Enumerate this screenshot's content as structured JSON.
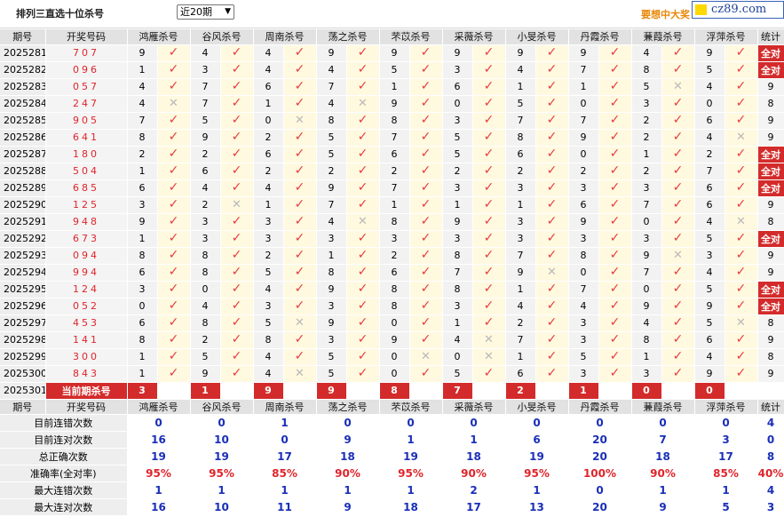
{
  "page": {
    "title": "排列三直选十位杀号",
    "period_select": "近20期",
    "promo": "要想中大奖",
    "logo": "cz89.com"
  },
  "columns": {
    "period": "期号",
    "draw": "开奖号码",
    "killers": [
      "鸿雁杀号",
      "谷风杀号",
      "周南杀号",
      "荡之杀号",
      "芣苡杀号",
      "采薇杀号",
      "小旻杀号",
      "丹霞杀号",
      "蒹葭杀号",
      "浮萍杀号"
    ],
    "total": "统计"
  },
  "marks": {
    "check": "✓",
    "cross": "✕"
  },
  "rows": [
    {
      "period": "2025281",
      "draw": "707",
      "kills": [
        "9",
        "4",
        "4",
        "9",
        "9",
        "9",
        "9",
        "9",
        "4",
        "9"
      ],
      "hits": [
        1,
        1,
        1,
        1,
        1,
        1,
        1,
        1,
        1,
        1
      ],
      "total": "全对"
    },
    {
      "period": "2025282",
      "draw": "096",
      "kills": [
        "1",
        "3",
        "4",
        "4",
        "5",
        "3",
        "4",
        "7",
        "8",
        "5"
      ],
      "hits": [
        1,
        1,
        1,
        1,
        1,
        1,
        1,
        1,
        1,
        1
      ],
      "total": "全对"
    },
    {
      "period": "2025283",
      "draw": "057",
      "kills": [
        "4",
        "7",
        "6",
        "7",
        "1",
        "6",
        "1",
        "1",
        "5",
        "4"
      ],
      "hits": [
        1,
        1,
        1,
        1,
        1,
        1,
        1,
        1,
        0,
        1
      ],
      "total": "9"
    },
    {
      "period": "2025284",
      "draw": "247",
      "kills": [
        "4",
        "7",
        "1",
        "4",
        "9",
        "0",
        "5",
        "0",
        "3",
        "0"
      ],
      "hits": [
        0,
        1,
        1,
        0,
        1,
        1,
        1,
        1,
        1,
        1
      ],
      "total": "8"
    },
    {
      "period": "2025285",
      "draw": "905",
      "kills": [
        "7",
        "5",
        "0",
        "8",
        "8",
        "3",
        "7",
        "7",
        "2",
        "6"
      ],
      "hits": [
        1,
        1,
        0,
        1,
        1,
        1,
        1,
        1,
        1,
        1
      ],
      "total": "9"
    },
    {
      "period": "2025286",
      "draw": "641",
      "kills": [
        "8",
        "9",
        "2",
        "5",
        "7",
        "5",
        "8",
        "9",
        "2",
        "4"
      ],
      "hits": [
        1,
        1,
        1,
        1,
        1,
        1,
        1,
        1,
        1,
        0
      ],
      "total": "9"
    },
    {
      "period": "2025287",
      "draw": "180",
      "kills": [
        "2",
        "2",
        "6",
        "5",
        "6",
        "5",
        "6",
        "0",
        "1",
        "2"
      ],
      "hits": [
        1,
        1,
        1,
        1,
        1,
        1,
        1,
        1,
        1,
        1
      ],
      "total": "全对"
    },
    {
      "period": "2025288",
      "draw": "504",
      "kills": [
        "1",
        "6",
        "2",
        "2",
        "2",
        "2",
        "2",
        "2",
        "2",
        "7"
      ],
      "hits": [
        1,
        1,
        1,
        1,
        1,
        1,
        1,
        1,
        1,
        1
      ],
      "total": "全对"
    },
    {
      "period": "2025289",
      "draw": "685",
      "kills": [
        "6",
        "4",
        "4",
        "9",
        "7",
        "3",
        "3",
        "3",
        "3",
        "6"
      ],
      "hits": [
        1,
        1,
        1,
        1,
        1,
        1,
        1,
        1,
        1,
        1
      ],
      "total": "全对"
    },
    {
      "period": "2025290",
      "draw": "125",
      "kills": [
        "3",
        "2",
        "1",
        "7",
        "1",
        "1",
        "1",
        "6",
        "7",
        "6"
      ],
      "hits": [
        1,
        0,
        1,
        1,
        1,
        1,
        1,
        1,
        1,
        1
      ],
      "total": "9"
    },
    {
      "period": "2025291",
      "draw": "948",
      "kills": [
        "9",
        "3",
        "3",
        "4",
        "8",
        "9",
        "3",
        "9",
        "0",
        "4"
      ],
      "hits": [
        1,
        1,
        1,
        0,
        1,
        1,
        1,
        1,
        1,
        0
      ],
      "total": "8"
    },
    {
      "period": "2025292",
      "draw": "673",
      "kills": [
        "1",
        "3",
        "3",
        "3",
        "3",
        "3",
        "3",
        "3",
        "3",
        "5"
      ],
      "hits": [
        1,
        1,
        1,
        1,
        1,
        1,
        1,
        1,
        1,
        1
      ],
      "total": "全对"
    },
    {
      "period": "2025293",
      "draw": "094",
      "kills": [
        "8",
        "8",
        "2",
        "1",
        "2",
        "8",
        "7",
        "8",
        "9",
        "3"
      ],
      "hits": [
        1,
        1,
        1,
        1,
        1,
        1,
        1,
        1,
        0,
        1
      ],
      "total": "9"
    },
    {
      "period": "2025294",
      "draw": "994",
      "kills": [
        "6",
        "8",
        "5",
        "8",
        "6",
        "7",
        "9",
        "0",
        "7",
        "4"
      ],
      "hits": [
        1,
        1,
        1,
        1,
        1,
        1,
        0,
        1,
        1,
        1
      ],
      "total": "9"
    },
    {
      "period": "2025295",
      "draw": "124",
      "kills": [
        "3",
        "0",
        "4",
        "9",
        "8",
        "8",
        "1",
        "7",
        "0",
        "5"
      ],
      "hits": [
        1,
        1,
        1,
        1,
        1,
        1,
        1,
        1,
        1,
        1
      ],
      "total": "全对"
    },
    {
      "period": "2025296",
      "draw": "052",
      "kills": [
        "0",
        "4",
        "3",
        "3",
        "8",
        "3",
        "4",
        "4",
        "9",
        "9"
      ],
      "hits": [
        1,
        1,
        1,
        1,
        1,
        1,
        1,
        1,
        1,
        1
      ],
      "total": "全对"
    },
    {
      "period": "2025297",
      "draw": "453",
      "kills": [
        "6",
        "8",
        "5",
        "9",
        "0",
        "1",
        "2",
        "3",
        "4",
        "5"
      ],
      "hits": [
        1,
        1,
        0,
        1,
        1,
        1,
        1,
        1,
        1,
        0
      ],
      "total": "8"
    },
    {
      "period": "2025298",
      "draw": "141",
      "kills": [
        "8",
        "2",
        "8",
        "3",
        "9",
        "4",
        "7",
        "3",
        "8",
        "6"
      ],
      "hits": [
        1,
        1,
        1,
        1,
        1,
        0,
        1,
        1,
        1,
        1
      ],
      "total": "9"
    },
    {
      "period": "2025299",
      "draw": "300",
      "kills": [
        "1",
        "5",
        "4",
        "5",
        "0",
        "0",
        "1",
        "5",
        "1",
        "4"
      ],
      "hits": [
        1,
        1,
        1,
        1,
        0,
        0,
        1,
        1,
        1,
        1
      ],
      "total": "8"
    },
    {
      "period": "2025300",
      "draw": "843",
      "kills": [
        "1",
        "9",
        "4",
        "5",
        "0",
        "5",
        "6",
        "3",
        "3",
        "9"
      ],
      "hits": [
        1,
        1,
        0,
        1,
        1,
        1,
        1,
        1,
        1,
        1
      ],
      "total": "9"
    }
  ],
  "current": {
    "period": "2025301",
    "label": "当前期杀号",
    "kills": [
      "3",
      "1",
      "9",
      "9",
      "8",
      "7",
      "2",
      "1",
      "0",
      "0"
    ]
  },
  "stats": [
    {
      "label": "目前连错次数",
      "values": [
        "0",
        "0",
        "1",
        "0",
        "0",
        "0",
        "0",
        "0",
        "0",
        "0"
      ],
      "total": "4",
      "type": "n"
    },
    {
      "label": "目前连对次数",
      "values": [
        "16",
        "10",
        "0",
        "9",
        "1",
        "1",
        "6",
        "20",
        "7",
        "3"
      ],
      "total": "0",
      "type": "n"
    },
    {
      "label": "总正确次数",
      "values": [
        "19",
        "19",
        "17",
        "18",
        "19",
        "18",
        "19",
        "20",
        "18",
        "17"
      ],
      "total": "8",
      "type": "n"
    },
    {
      "label": "准确率(全对率)",
      "values": [
        "95%",
        "95%",
        "85%",
        "90%",
        "95%",
        "90%",
        "95%",
        "100%",
        "90%",
        "85%"
      ],
      "total": "40%",
      "type": "p"
    },
    {
      "label": "最大连错次数",
      "values": [
        "1",
        "1",
        "1",
        "1",
        "1",
        "2",
        "1",
        "0",
        "1",
        "1"
      ],
      "total": "4",
      "type": "n"
    },
    {
      "label": "最大连对次数",
      "values": [
        "16",
        "10",
        "11",
        "9",
        "18",
        "17",
        "13",
        "20",
        "9",
        "5"
      ],
      "total": "3",
      "type": "n"
    }
  ]
}
